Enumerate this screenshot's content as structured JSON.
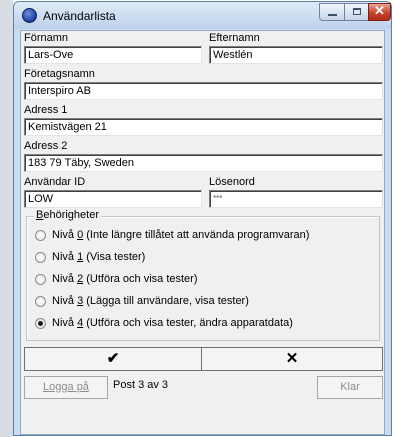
{
  "window": {
    "title": "Användarlista",
    "minimize_glyph": "",
    "maximize_glyph": "",
    "close_glyph": "✕"
  },
  "icons": {
    "app": "globe-icon",
    "ok": "checkmark-icon",
    "cancel": "x-icon"
  },
  "fields": {
    "first_name": {
      "label": "Förnamn",
      "value": "Lars-Ove"
    },
    "last_name": {
      "label": "Efternamn",
      "value": "Westlén"
    },
    "company": {
      "label": "Företagsnamn",
      "value": "Interspiro AB"
    },
    "address1": {
      "label": "Adress 1",
      "value": "Kemistvägen 21"
    },
    "address2": {
      "label": "Adress 2",
      "value": "183 79 Täby, Sweden"
    },
    "user_id": {
      "label": "Användar ID",
      "value": "LOW"
    },
    "password": {
      "label": "Lösenord",
      "value": "***"
    }
  },
  "permissions": {
    "label": "Behörigheter",
    "selected_index": 4,
    "options": [
      {
        "prefix": "Nivå ",
        "num": "0",
        "desc": " (Inte längre tillåtet att använda programvaran)"
      },
      {
        "prefix": "Nivå ",
        "num": "1",
        "desc": " (Visa tester)"
      },
      {
        "prefix": "Nivå ",
        "num": "2",
        "desc": " (Utföra och visa tester)"
      },
      {
        "prefix": "Nivå ",
        "num": "3",
        "desc": " (Lägga till användare, visa tester)"
      },
      {
        "prefix": "Nivå ",
        "num": "4",
        "desc": " (Utföra och visa tester, ändra apparatdata)"
      }
    ]
  },
  "buttons": {
    "ok_glyph": "✔",
    "cancel_glyph": "✕",
    "login": "Logga på",
    "close": "Klar"
  },
  "status": {
    "record": "Post 3 av 3"
  },
  "colors": {
    "titlebar": "#c9dbf0",
    "close_button": "#c9412c",
    "dialog_bg": "#f0f0f0"
  }
}
